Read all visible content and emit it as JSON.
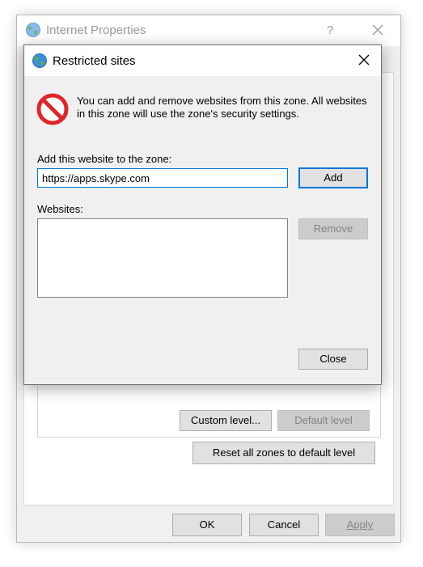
{
  "internet_properties": {
    "title": "Internet Properties",
    "help_label": "?",
    "custom_level_label": "Custom level...",
    "default_level_label": "Default level",
    "reset_zones_label": "Reset all zones to default level",
    "ok_label": "OK",
    "cancel_label": "Cancel",
    "apply_label": "Apply"
  },
  "restricted_sites": {
    "title": "Restricted sites",
    "message": "You can add and remove websites from this zone. All websites in this zone will use the zone's security settings.",
    "add_label": "Add this website to the zone:",
    "url_value": "https://apps.skype.com",
    "add_button": "Add",
    "websites_label": "Websites:",
    "websites": [],
    "remove_button": "Remove",
    "close_button": "Close"
  },
  "colors": {
    "accent": "#0078d7",
    "dialog_bg": "#f0f0f0",
    "button_bg": "#e1e1e1",
    "disabled_text": "#838383",
    "warning_red": "#e0262b"
  },
  "icons": [
    "globe-icon",
    "close-icon",
    "prohibited-icon"
  ]
}
